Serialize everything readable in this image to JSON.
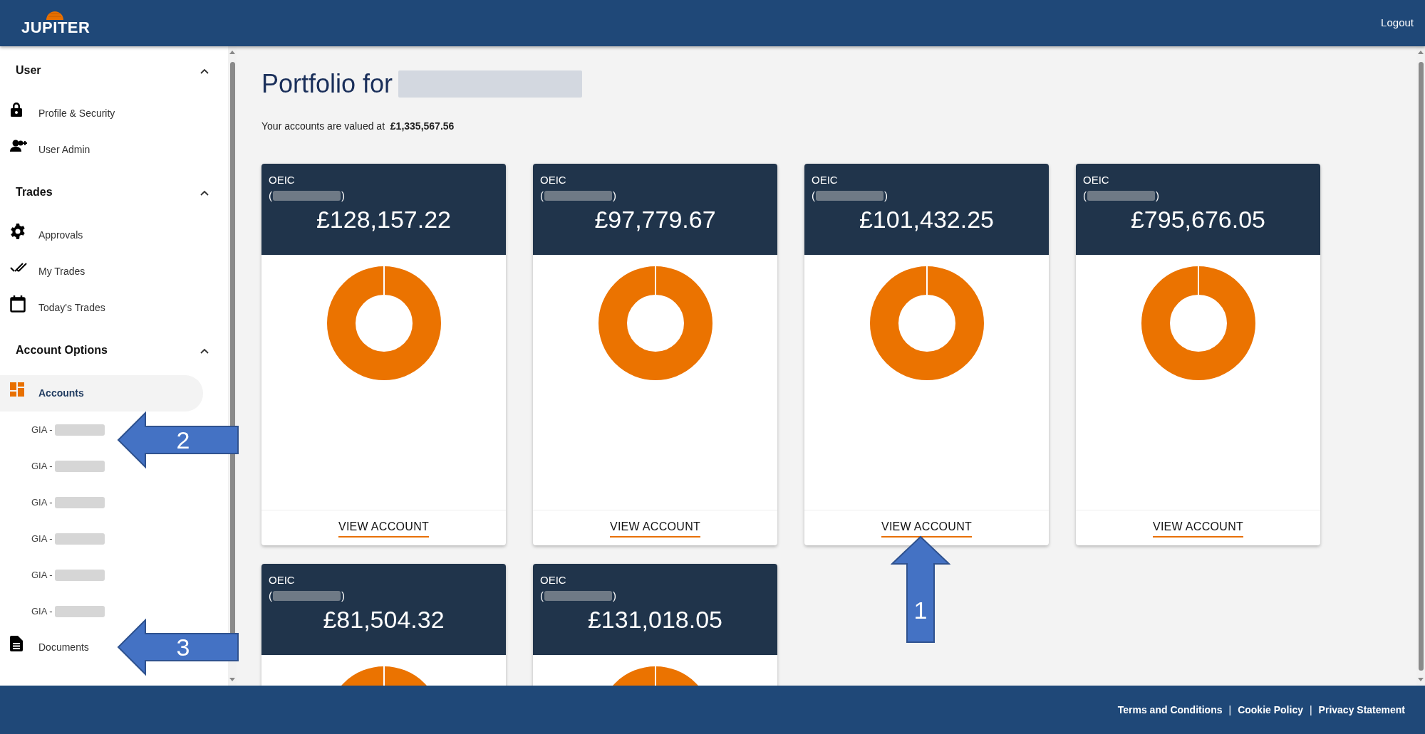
{
  "header": {
    "logo": "JUPITER",
    "logout": "Logout"
  },
  "sidebar": {
    "sections": [
      {
        "title": "User",
        "expanded": true,
        "items": [
          {
            "label": "Profile & Security",
            "selected": false
          },
          {
            "label": "User Admin",
            "selected": false
          }
        ]
      },
      {
        "title": "Trades",
        "expanded": true,
        "items": [
          {
            "label": "Approvals",
            "selected": false
          },
          {
            "label": "My Trades",
            "selected": false
          },
          {
            "label": "Today's Trades",
            "selected": false
          }
        ]
      },
      {
        "title": "Account Options",
        "expanded": true,
        "items": [
          {
            "label": "Accounts",
            "selected": true,
            "children": [
              {
                "label": "GIA -",
                "redacted": true
              },
              {
                "label": "GIA -",
                "redacted": true
              },
              {
                "label": "GIA -",
                "redacted": true
              },
              {
                "label": "GIA -",
                "redacted": true
              },
              {
                "label": "GIA -",
                "redacted": true
              },
              {
                "label": "GIA -",
                "redacted": true
              }
            ]
          },
          {
            "label": "Documents",
            "selected": false
          }
        ]
      }
    ]
  },
  "main": {
    "title": "Portfolio for",
    "title_redacted": true,
    "summary": "Your accounts are valued at  **£1,335,567.56**",
    "cards": [
      {
        "type": "OEIC",
        "open": "(",
        "close": ")",
        "amount": "£128,157.22",
        "action": "VIEW ACCOUNT"
      },
      {
        "type": "OEIC",
        "open": "(",
        "close": ")",
        "amount": "£97,779.67",
        "action": "VIEW ACCOUNT"
      },
      {
        "type": "OEIC",
        "open": "(",
        "close": ")",
        "amount": "£101,432.25",
        "action": "VIEW ACCOUNT"
      },
      {
        "type": "OEIC",
        "open": "(",
        "close": ")",
        "amount": "£795,676.05",
        "action": "VIEW ACCOUNT"
      },
      {
        "type": "OEIC",
        "open": "(",
        "close": ")",
        "amount": "£81,504.32"
      },
      {
        "type": "OEIC",
        "open": "(",
        "close": ")",
        "amount": "£131,018.05"
      }
    ]
  },
  "footer": {
    "items": [
      {
        "kind": "link",
        "text": "Terms and Conditions"
      },
      {
        "kind": "separator",
        "text": "|"
      },
      {
        "kind": "link",
        "text": "Cookie Policy"
      },
      {
        "kind": "separator",
        "text": "|"
      },
      {
        "kind": "link",
        "text": "Privacy Statement"
      }
    ]
  },
  "callouts": [
    {
      "number": "1",
      "kind": "up"
    },
    {
      "number": "2",
      "kind": "left"
    },
    {
      "number": "3",
      "kind": "left"
    }
  ]
}
